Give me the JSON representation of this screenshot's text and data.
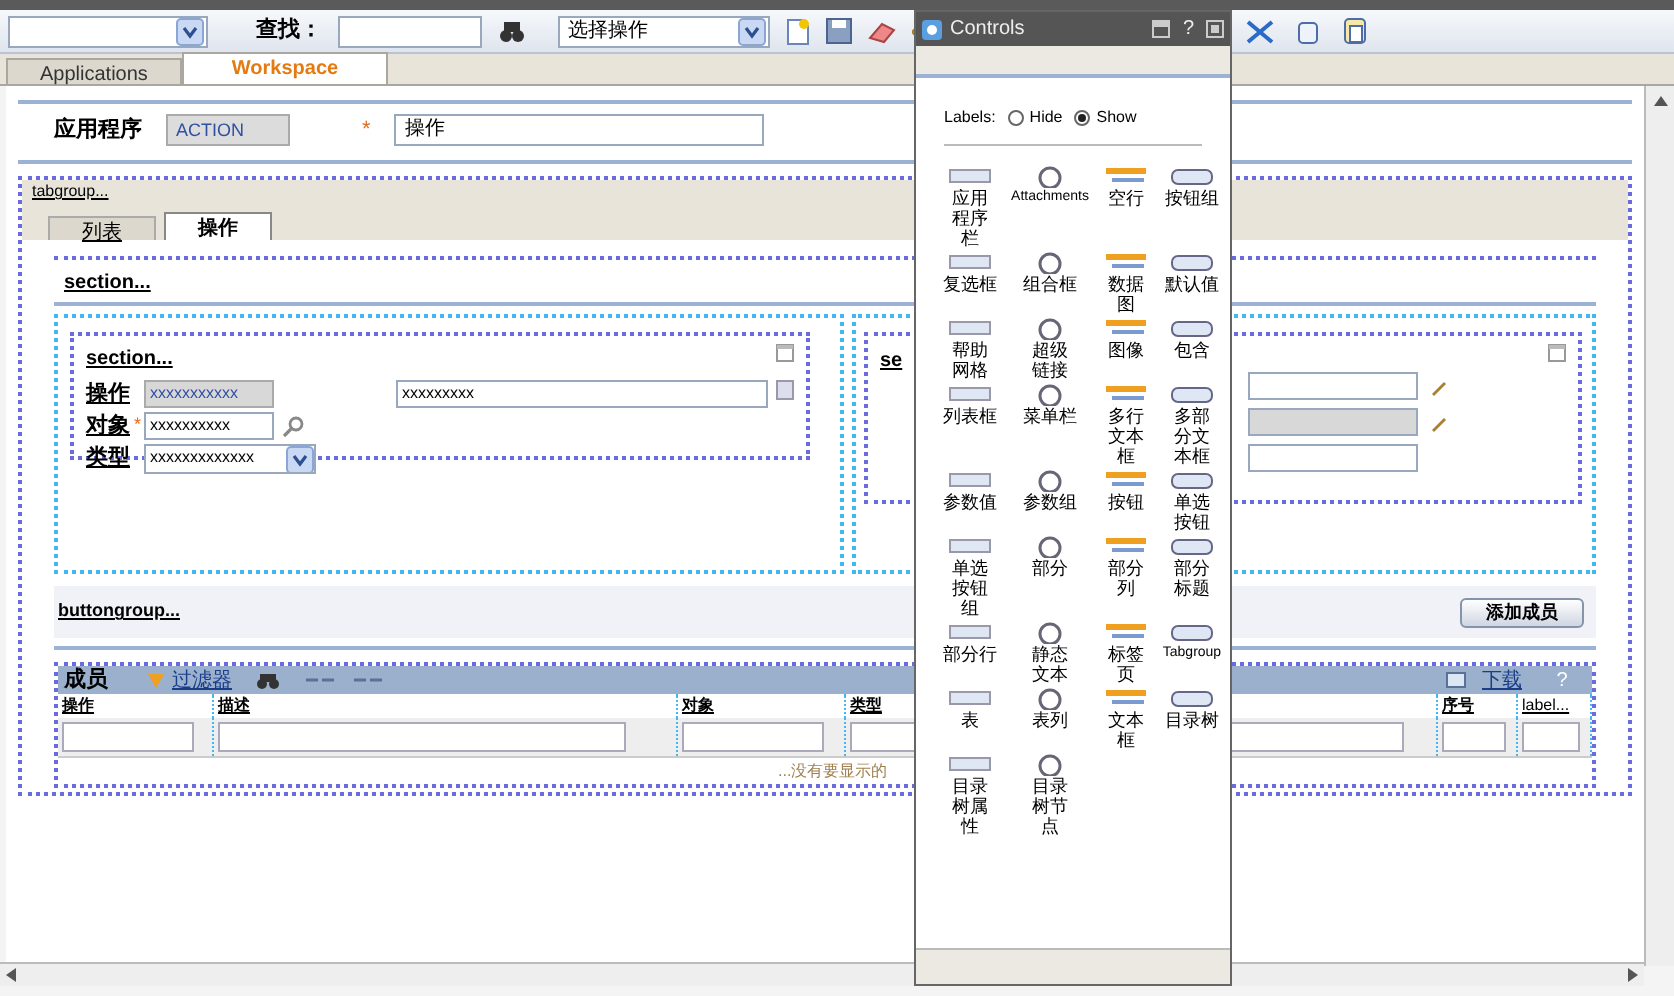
{
  "toolbar": {
    "search_label": "查找：",
    "action_select": "选择操作"
  },
  "tabs": [
    {
      "label": "Applications",
      "selected": false
    },
    {
      "label": "Workspace",
      "selected": true
    }
  ],
  "header": {
    "app_label": "应用程序",
    "app_value": "ACTION",
    "required_mark": "*",
    "name_value": "操作"
  },
  "tabgroup": {
    "label": "tabgroup...",
    "tabs": [
      {
        "label": "列表",
        "selected": false
      },
      {
        "label": "操作",
        "selected": true
      }
    ]
  },
  "section": {
    "label": "section...",
    "left": {
      "label": "section...",
      "fields": [
        {
          "label": "操作",
          "value": "xxxxxxxxxxx",
          "kind": "readonly"
        },
        {
          "label": "对象",
          "value": "xxxxxxxxxx",
          "kind": "lookup",
          "required_mark": "*"
        },
        {
          "label": "类型",
          "value": "xxxxxxxxxxxxx",
          "kind": "select"
        }
      ],
      "side_value": "xxxxxxxxx"
    },
    "right": {
      "label": "se"
    }
  },
  "buttongroup": {
    "label": "buttongroup...",
    "button": "添加成员"
  },
  "members": {
    "title": "成员",
    "filter": "过滤器",
    "download": "下载",
    "help": "?",
    "columns": [
      "操作",
      "描述",
      "对象",
      "类型",
      "",
      "序号",
      "label..."
    ],
    "empty_message": "...没有要显示的"
  },
  "palette": {
    "title": "Controls",
    "help": "?",
    "labels_caption": "Labels:",
    "label_options": [
      {
        "label": "Hide",
        "selected": false
      },
      {
        "label": "Show",
        "selected": true
      }
    ],
    "items": [
      "应用程序栏",
      "Attachments",
      "空行",
      "按钮组",
      "复选框",
      "组合框",
      "数据图",
      "默认值",
      "帮助网格",
      "超级链接",
      "图像",
      "包含",
      "列表框",
      "菜单栏",
      "多行文本框",
      "多部分文本框",
      "参数值",
      "参数组",
      "按钮",
      "单选按钮",
      "单选按钮组",
      "部分",
      "部分列",
      "部分标题",
      "部分行",
      "静态文本",
      "标签页",
      "Tabgroup",
      "表",
      "表列",
      "文本框",
      "目录树",
      "目录树属性",
      "目录树节点"
    ]
  }
}
